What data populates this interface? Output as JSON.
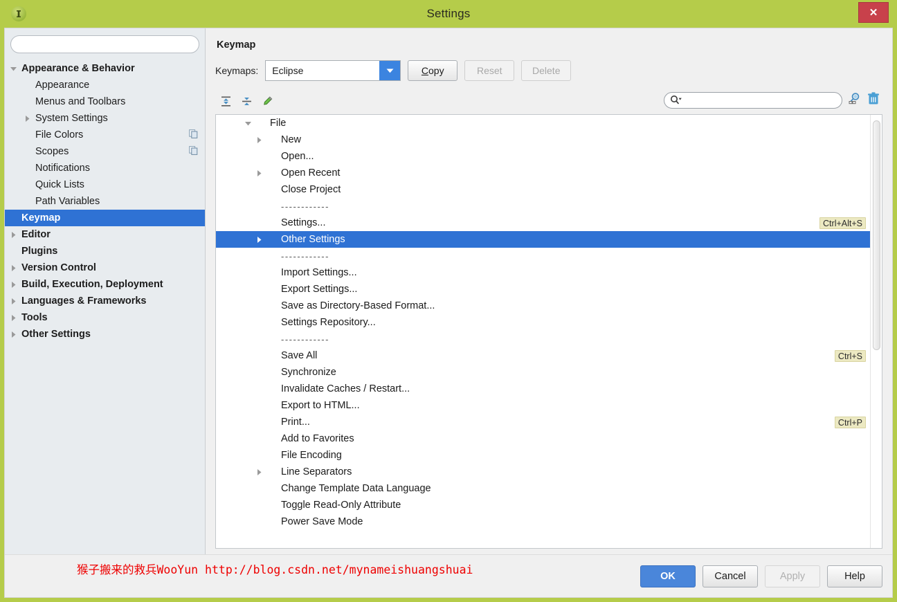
{
  "window": {
    "title": "Settings",
    "app_icon": "intellij-icon",
    "close_label": "✕",
    "frame_color": "#b5cc4a",
    "accent_color": "#2f72d4"
  },
  "sidebar": {
    "search_placeholder": "",
    "search_value": "",
    "items": [
      {
        "label": "Appearance & Behavior",
        "indent": 0,
        "bold": true,
        "arrow": "down",
        "copy": false,
        "selected": false
      },
      {
        "label": "Appearance",
        "indent": 1,
        "bold": false,
        "arrow": "none",
        "copy": false,
        "selected": false
      },
      {
        "label": "Menus and Toolbars",
        "indent": 1,
        "bold": false,
        "arrow": "none",
        "copy": false,
        "selected": false
      },
      {
        "label": "System Settings",
        "indent": 1,
        "bold": false,
        "arrow": "right",
        "copy": false,
        "selected": false
      },
      {
        "label": "File Colors",
        "indent": 1,
        "bold": false,
        "arrow": "none",
        "copy": true,
        "selected": false
      },
      {
        "label": "Scopes",
        "indent": 1,
        "bold": false,
        "arrow": "none",
        "copy": true,
        "selected": false
      },
      {
        "label": "Notifications",
        "indent": 1,
        "bold": false,
        "arrow": "none",
        "copy": false,
        "selected": false
      },
      {
        "label": "Quick Lists",
        "indent": 1,
        "bold": false,
        "arrow": "none",
        "copy": false,
        "selected": false
      },
      {
        "label": "Path Variables",
        "indent": 1,
        "bold": false,
        "arrow": "none",
        "copy": false,
        "selected": false
      },
      {
        "label": "Keymap",
        "indent": 0,
        "bold": true,
        "arrow": "none",
        "copy": false,
        "selected": true
      },
      {
        "label": "Editor",
        "indent": 0,
        "bold": true,
        "arrow": "right",
        "copy": false,
        "selected": false
      },
      {
        "label": "Plugins",
        "indent": 0,
        "bold": true,
        "arrow": "none",
        "copy": false,
        "selected": false
      },
      {
        "label": "Version Control",
        "indent": 0,
        "bold": true,
        "arrow": "right",
        "copy": false,
        "selected": false
      },
      {
        "label": "Build, Execution, Deployment",
        "indent": 0,
        "bold": true,
        "arrow": "right",
        "copy": false,
        "selected": false
      },
      {
        "label": "Languages & Frameworks",
        "indent": 0,
        "bold": true,
        "arrow": "right",
        "copy": false,
        "selected": false
      },
      {
        "label": "Tools",
        "indent": 0,
        "bold": true,
        "arrow": "right",
        "copy": false,
        "selected": false
      },
      {
        "label": "Other Settings",
        "indent": 0,
        "bold": true,
        "arrow": "right",
        "copy": false,
        "selected": false
      }
    ]
  },
  "panel": {
    "title": "Keymap",
    "keymaps_label": "Keymaps:",
    "keymap_selected": "Eclipse",
    "buttons": {
      "copy": "Copy",
      "copy_mnemonic": "C",
      "reset": "Reset",
      "delete": "Delete",
      "reset_enabled": false,
      "delete_enabled": false
    },
    "toolbar_icons": [
      "expand-all-icon",
      "collapse-all-icon",
      "edit-shortcut-icon"
    ],
    "find_placeholder": "",
    "find_value": "",
    "find_icons": [
      "find-by-shortcut-icon",
      "clear-filter-icon"
    ]
  },
  "keymap_tree": {
    "rows": [
      {
        "label": "File",
        "indent": 0,
        "arrow": "down",
        "type": "item",
        "shortcut": "",
        "selected": false
      },
      {
        "label": "New",
        "indent": 1,
        "arrow": "right",
        "type": "item",
        "shortcut": "",
        "selected": false
      },
      {
        "label": "Open...",
        "indent": 1,
        "arrow": "none",
        "type": "item",
        "shortcut": "",
        "selected": false
      },
      {
        "label": "Open Recent",
        "indent": 1,
        "arrow": "right",
        "type": "item",
        "shortcut": "",
        "selected": false
      },
      {
        "label": "Close Project",
        "indent": 1,
        "arrow": "none",
        "type": "item",
        "shortcut": "",
        "selected": false
      },
      {
        "label": "------------",
        "indent": 1,
        "arrow": "none",
        "type": "separator",
        "shortcut": "",
        "selected": false
      },
      {
        "label": "Settings...",
        "indent": 1,
        "arrow": "none",
        "type": "item",
        "shortcut": "Ctrl+Alt+S",
        "selected": false
      },
      {
        "label": "Other Settings",
        "indent": 1,
        "arrow": "right",
        "type": "item",
        "shortcut": "",
        "selected": true
      },
      {
        "label": "------------",
        "indent": 1,
        "arrow": "none",
        "type": "separator",
        "shortcut": "",
        "selected": false
      },
      {
        "label": "Import Settings...",
        "indent": 1,
        "arrow": "none",
        "type": "item",
        "shortcut": "",
        "selected": false
      },
      {
        "label": "Export Settings...",
        "indent": 1,
        "arrow": "none",
        "type": "item",
        "shortcut": "",
        "selected": false
      },
      {
        "label": "Save as Directory-Based Format...",
        "indent": 1,
        "arrow": "none",
        "type": "item",
        "shortcut": "",
        "selected": false
      },
      {
        "label": "Settings Repository...",
        "indent": 1,
        "arrow": "none",
        "type": "item",
        "shortcut": "",
        "selected": false
      },
      {
        "label": "------------",
        "indent": 1,
        "arrow": "none",
        "type": "separator",
        "shortcut": "",
        "selected": false
      },
      {
        "label": "Save All",
        "indent": 1,
        "arrow": "none",
        "type": "item",
        "shortcut": "Ctrl+S",
        "selected": false
      },
      {
        "label": "Synchronize",
        "indent": 1,
        "arrow": "none",
        "type": "item",
        "shortcut": "",
        "selected": false
      },
      {
        "label": "Invalidate Caches / Restart...",
        "indent": 1,
        "arrow": "none",
        "type": "item",
        "shortcut": "",
        "selected": false
      },
      {
        "label": "Export to HTML...",
        "indent": 1,
        "arrow": "none",
        "type": "item",
        "shortcut": "",
        "selected": false
      },
      {
        "label": "Print...",
        "indent": 1,
        "arrow": "none",
        "type": "item",
        "shortcut": "Ctrl+P",
        "selected": false
      },
      {
        "label": "Add to Favorites",
        "indent": 1,
        "arrow": "none",
        "type": "item",
        "shortcut": "",
        "selected": false
      },
      {
        "label": "File Encoding",
        "indent": 1,
        "arrow": "none",
        "type": "item",
        "shortcut": "",
        "selected": false
      },
      {
        "label": "Line Separators",
        "indent": 1,
        "arrow": "right",
        "type": "item",
        "shortcut": "",
        "selected": false
      },
      {
        "label": "Change Template Data Language",
        "indent": 1,
        "arrow": "none",
        "type": "item",
        "shortcut": "",
        "selected": false
      },
      {
        "label": "Toggle Read-Only Attribute",
        "indent": 1,
        "arrow": "none",
        "type": "item",
        "shortcut": "",
        "selected": false
      },
      {
        "label": "Power Save Mode",
        "indent": 1,
        "arrow": "none",
        "type": "item",
        "shortcut": "",
        "selected": false
      }
    ]
  },
  "footer": {
    "watermark": "猴子搬来的救兵WooYun http://blog.csdn.net/mynameishuangshuai",
    "ok": "OK",
    "cancel": "Cancel",
    "apply": "Apply",
    "help": "Help",
    "apply_enabled": false
  }
}
